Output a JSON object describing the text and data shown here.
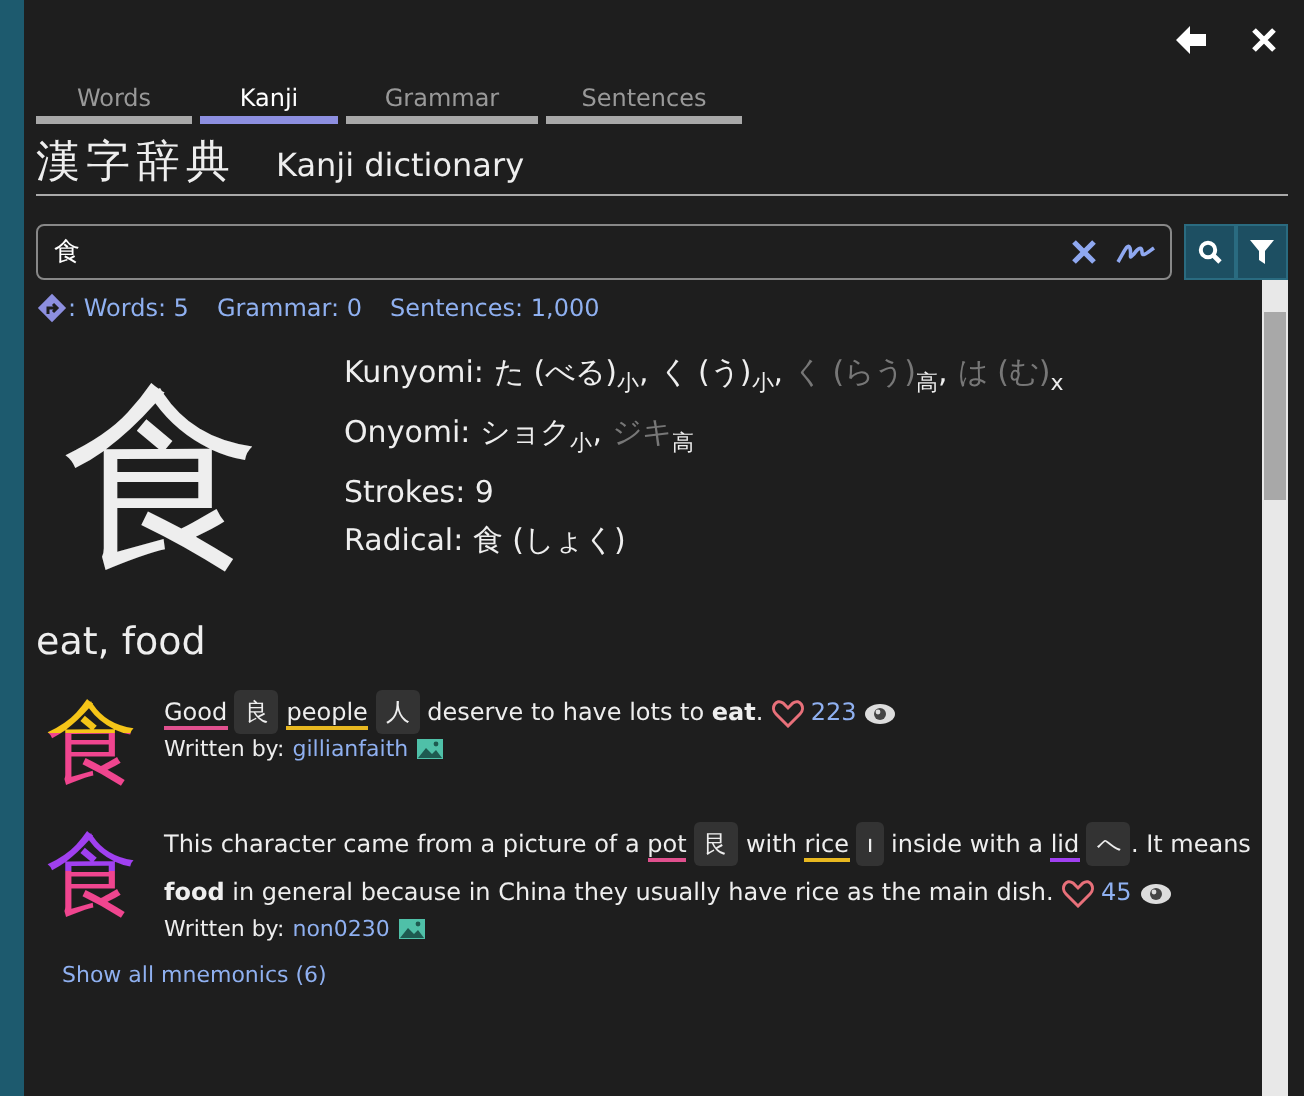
{
  "tabs": [
    {
      "label": "Words",
      "selected": false
    },
    {
      "label": "Kanji",
      "selected": true
    },
    {
      "label": "Grammar",
      "selected": false
    },
    {
      "label": "Sentences",
      "selected": false
    }
  ],
  "heading": {
    "japanese": "漢字辞典",
    "english": "Kanji dictionary"
  },
  "search": {
    "value": "食"
  },
  "counts": [
    {
      "text": ": Words: 5"
    },
    {
      "text": "Grammar: 0"
    },
    {
      "text": "Sentences: 1,000"
    }
  ],
  "kanji": {
    "character": "食",
    "meaning": "eat, food",
    "kunyomi": {
      "label": "Kunyomi:",
      "separator": ",",
      "readings": [
        {
          "text": "た (べる)",
          "tag": "小",
          "common": true
        },
        {
          "text": "く (う)",
          "tag": "小",
          "common": true
        },
        {
          "text": "く (らう)",
          "tag": "高",
          "common": false
        },
        {
          "text": "は (む)",
          "tag": "x",
          "common": false
        }
      ]
    },
    "onyomi": {
      "label": "Onyomi:",
      "separator": ",",
      "readings": [
        {
          "text": "ショク",
          "tag": "小",
          "common": true
        },
        {
          "text": "ジキ",
          "tag": "高",
          "common": false
        }
      ]
    },
    "strokes": "Strokes: 9",
    "radical": "Radical: 食 (しょく)"
  },
  "mnemonics": [
    {
      "glyph": "食",
      "segments": [
        {
          "kind": "link",
          "text": "Good",
          "color": "#e0508e"
        },
        {
          "kind": "chip",
          "text": "良"
        },
        {
          "kind": "link",
          "text": "people",
          "color": "#e8b820"
        },
        {
          "kind": "chip",
          "text": "人"
        },
        {
          "kind": "text",
          "text": "deserve to have lots to"
        },
        {
          "kind": "bold",
          "text": "eat"
        },
        {
          "kind": "text",
          "text": "."
        }
      ],
      "likes": "223",
      "author_label": "Written by:",
      "author": "gillianfaith"
    },
    {
      "glyph": "食",
      "segments": [
        {
          "kind": "text",
          "text": "This character came from a picture of a"
        },
        {
          "kind": "link",
          "text": "pot",
          "color": "#e0508e"
        },
        {
          "kind": "chip",
          "text": "艮"
        },
        {
          "kind": "text",
          "text": "with"
        },
        {
          "kind": "link",
          "text": "rice",
          "color": "#e8b820"
        },
        {
          "kind": "chip",
          "text": "ı"
        },
        {
          "kind": "text",
          "text": "inside with a"
        },
        {
          "kind": "link",
          "text": "lid",
          "color": "#a040f0"
        },
        {
          "kind": "chip",
          "text": "へ"
        },
        {
          "kind": "text",
          "text": ". It means"
        },
        {
          "kind": "bold",
          "text": "food"
        },
        {
          "kind": "text",
          "text": "in general because in China they usually have rice as the main dish."
        }
      ],
      "likes": "45",
      "author_label": "Written by:",
      "author": "non0230"
    }
  ],
  "show_all": "Show all mnemonics (6)"
}
